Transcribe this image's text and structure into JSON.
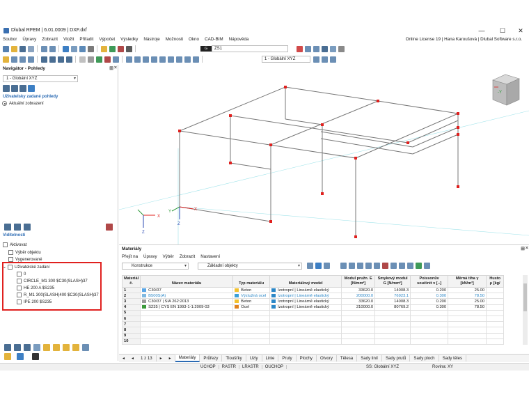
{
  "window": {
    "title": "Dlubal RFEM | 6.01.0009 | DXF.dxf",
    "minimize": "—",
    "maximize": "☐",
    "close": "✕"
  },
  "menu": [
    "Soubor",
    "Úpravy",
    "Zobrazit",
    "Vložit",
    "Přiřadit",
    "Výpočet",
    "Výsledky",
    "Nástroje",
    "Možnosti",
    "Okno",
    "CAD-BIM",
    "Nápověda"
  ],
  "license": "Online License 19 | Hana Karoušová | Dlubal Software s.r.o.",
  "toolbar": {
    "loadcase_tag": "G",
    "loadcase": "ZS1",
    "coord_system": "1 - Globální XYZ"
  },
  "navigator": {
    "title": "Navigátor - Pohledy",
    "view_select": "1 - Globální XYZ",
    "user_views_label": "Uživatelsky zadané pohledy",
    "current_view": "Aktuální zobrazení",
    "visibility_label": "Viditelnosti",
    "items": {
      "activate": "Aktivovat",
      "select_object": "Výběr objektu",
      "generated": "Vygenerované",
      "user_defined": "Uživatelské zadání",
      "sub": [
        "0",
        "CIRCLE_M1 300 $C30(SLASH)37",
        "HE 200 A $S235",
        "R_M1 300(SLASH)400 $C30(SLASH)37",
        "IPE 200 $S235"
      ]
    }
  },
  "axes": {
    "x": "X",
    "y": "Y",
    "z": "Z"
  },
  "materials": {
    "title": "Materiály",
    "menu": [
      "Přejít na",
      "Úpravy",
      "Výběr",
      "Zobrazit",
      "Nastavení"
    ],
    "filter1": "Konstrukce",
    "filter2": "Základní objekty",
    "columns": {
      "no": "Materiál č.",
      "name": "Název materiálu",
      "type": "Typ materiálu",
      "model": "Materiálový model",
      "e": "Modul pružn. E [N/mm²]",
      "g": "Smykový modul G [N/mm²]",
      "nu": "Poissonův součinit v [--]",
      "gamma": "Měrná tíha γ [kN/m³]",
      "rho": "Husto ρ [kg/"
    },
    "rows": [
      {
        "no": "1",
        "name": "C30/37",
        "type": "Beton",
        "model": "Izotropní | Lineárně elastický",
        "e": "33620.0",
        "g": "14008.3",
        "nu": "0.200",
        "gamma": "25.00",
        "color": "#5aa6e6",
        "typecolor": "#f2c12e"
      },
      {
        "no": "2",
        "name": "B500S(A)",
        "type": "Výztužná ocel",
        "model": "Izotropní | Lineárně elastický",
        "e": "200000.0",
        "g": "76923.1",
        "nu": "0.300",
        "gamma": "78.50",
        "color": "#7fb8e0",
        "typecolor": "#3aa0d8"
      },
      {
        "no": "3",
        "name": "C30/37 | SIA 262:2013",
        "type": "Beton",
        "model": "Izotropní | Lineárně elastický",
        "e": "33620.0",
        "g": "14008.3",
        "nu": "0.200",
        "gamma": "25.00",
        "color": "#9a9a9a",
        "typecolor": "#f2c12e"
      },
      {
        "no": "4",
        "name": "S235 | CYS EN 1993-1-1:2009-03",
        "type": "Ocel",
        "model": "Izotropní | Lineárně elastický",
        "e": "210000.0",
        "g": "80769.2",
        "nu": "0.300",
        "gamma": "78.50",
        "color": "#3a9a3a",
        "typecolor": "#e0821e"
      },
      {
        "no": "5"
      },
      {
        "no": "6"
      },
      {
        "no": "7"
      },
      {
        "no": "8"
      },
      {
        "no": "9"
      },
      {
        "no": "10"
      }
    ]
  },
  "pager": "1 z 13",
  "tabs": [
    "Materiály",
    "Průřezy",
    "Tloušťky",
    "Uzly",
    "Linie",
    "Pruty",
    "Plochy",
    "Otvory",
    "Tělesa",
    "Sady linií",
    "Sady prutů",
    "Sady ploch",
    "Sady těles"
  ],
  "status": [
    "ÚCHOP",
    "RASTR",
    "LRASTR",
    "OUCHOP"
  ],
  "status_right": {
    "cs": "SS: Globální XYZ",
    "plane": "Rovina: XY"
  },
  "colors": {
    "accent": "#2a6ab3",
    "highlight": "#e0201e",
    "node": "#e0201e",
    "member": "#777777"
  }
}
